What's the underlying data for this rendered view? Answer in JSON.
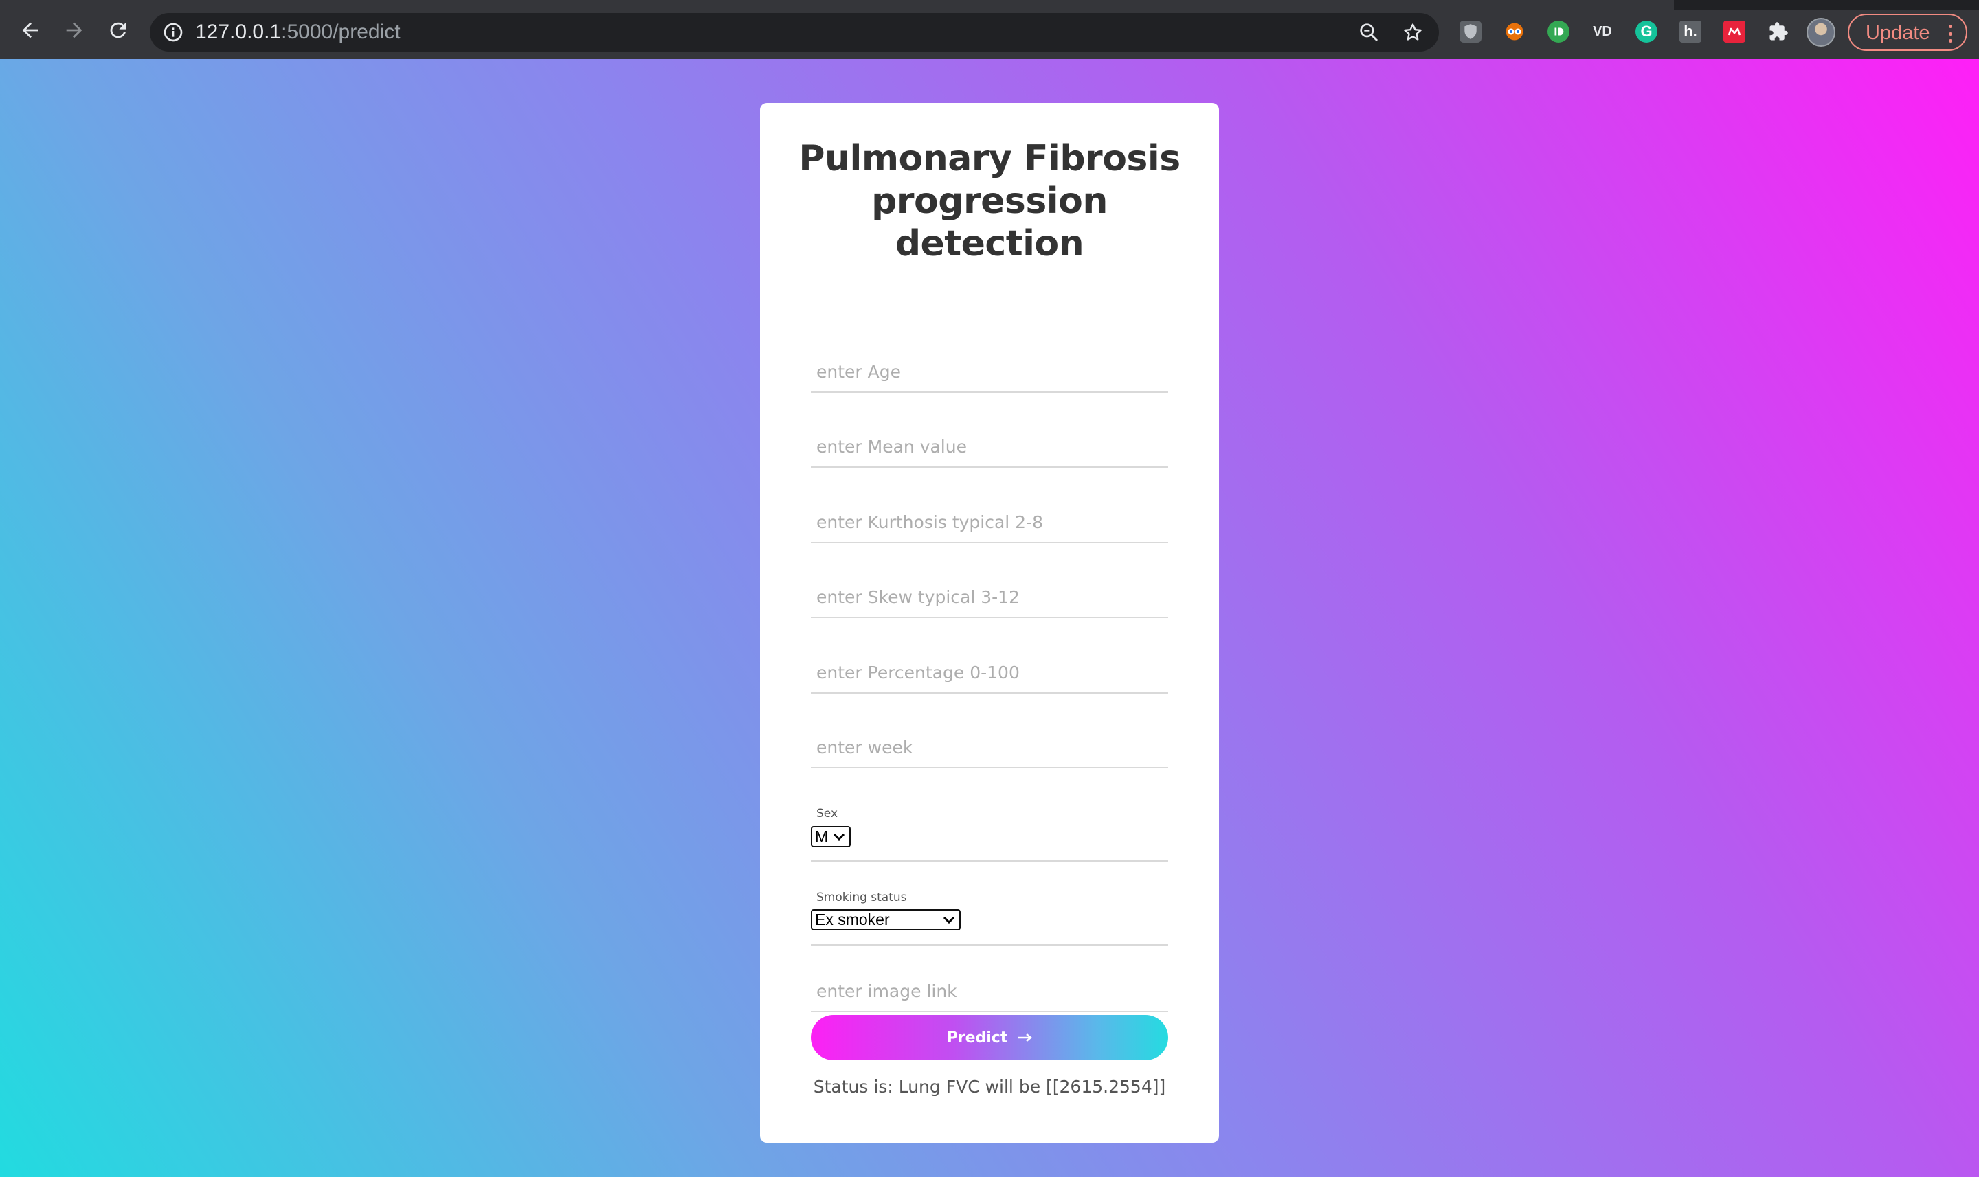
{
  "browser": {
    "url_host": "127.0.0.1",
    "url_path": ":5000/predict",
    "update_label": "Update",
    "extensions": [
      {
        "name": "shield-extension-icon",
        "label": "",
        "color": "#5f6368"
      },
      {
        "name": "eyes-extension-icon",
        "label": "",
        "color": "#e8710a"
      },
      {
        "name": "id-extension-icon",
        "label": "",
        "color": "#34a853"
      },
      {
        "name": "vd-extension-icon",
        "label": "VD",
        "color": "#35363a"
      },
      {
        "name": "grammarly-extension-icon",
        "label": "G",
        "color": "#15c39a"
      },
      {
        "name": "h-extension-icon",
        "label": "h.",
        "color": "#5f6368"
      },
      {
        "name": "mendeley-extension-icon",
        "label": "",
        "color": "#e8233c"
      }
    ]
  },
  "form": {
    "title": "Pulmonary Fibrosis progression detection",
    "fields": {
      "age": "enter Age",
      "mean": "enter Mean value",
      "kurthosis": "enter Kurthosis typical 2-8",
      "skew": "enter Skew typical 3-12",
      "percentage": "enter Percentage 0-100",
      "week": "enter week",
      "image_link": "enter image link"
    },
    "sex": {
      "label": "Sex",
      "selected": "M"
    },
    "smoking": {
      "label": "Smoking status",
      "selected": "Ex smoker"
    },
    "predict_label": "Predict",
    "status": "Status is: Lung FVC will be [[2615.2554]]"
  },
  "colors": {
    "gradient_start": "#22dbe0",
    "gradient_end": "#ff1ff7",
    "button_start": "#fc21f4",
    "button_end": "#25dbe0"
  }
}
